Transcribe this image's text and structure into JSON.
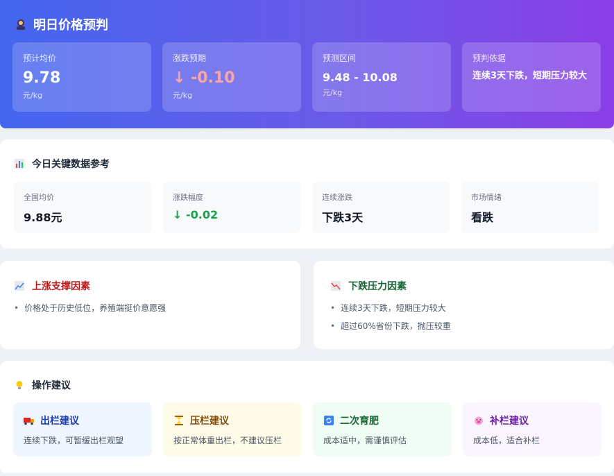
{
  "colors": {
    "hero_start": "#4466ee",
    "hero_end": "#8a3ee6",
    "down_red": "#fca5a5",
    "green": "#16a34a",
    "up_title": "#b91c1c",
    "down_title": "#166534"
  },
  "hero": {
    "title": "明日价格预判",
    "icon": "fortune-teller-icon",
    "cards": [
      {
        "label": "预计均价",
        "value": "9.78",
        "unit": "元/kg"
      },
      {
        "label": "涨跌预期",
        "value": "↓ -0.10",
        "unit": "元/kg"
      },
      {
        "label": "预测区间",
        "value": "9.48 - 10.08",
        "unit": "元/kg"
      },
      {
        "label": "预判依据",
        "text": "连续3天下跌，短期压力较大"
      }
    ]
  },
  "key": {
    "title": "今日关键数据参考",
    "icon": "bar-chart-icon",
    "cards": [
      {
        "label": "全国均价",
        "value": "9.88元"
      },
      {
        "label": "涨跌幅度",
        "value": "↓ -0.02"
      },
      {
        "label": "连续涨跌",
        "value": "下跌3天"
      },
      {
        "label": "市场情绪",
        "value": "看跌"
      }
    ]
  },
  "up": {
    "title": "上涨支撑因素",
    "icon": "trend-up-icon",
    "items": [
      "价格处于历史低位，养殖端挺价意愿强"
    ]
  },
  "down": {
    "title": "下跌压力因素",
    "icon": "trend-down-icon",
    "items": [
      "连续3天下跌，短期压力较大",
      "超过60%省份下跌，抛压较重"
    ]
  },
  "ops": {
    "title": "操作建议",
    "icon": "lightbulb-icon",
    "cards": [
      {
        "title": "出栏建议",
        "icon": "truck-icon",
        "desc": "连续下跌，可暂缓出栏观望"
      },
      {
        "title": "压栏建议",
        "icon": "hourglass-icon",
        "desc": "按正常体重出栏，不建议压栏"
      },
      {
        "title": "二次育肥",
        "icon": "refresh-icon",
        "desc": "成本适中，需谨慎评估"
      },
      {
        "title": "补栏建议",
        "icon": "pig-icon",
        "desc": "成本低，适合补栏"
      }
    ]
  }
}
